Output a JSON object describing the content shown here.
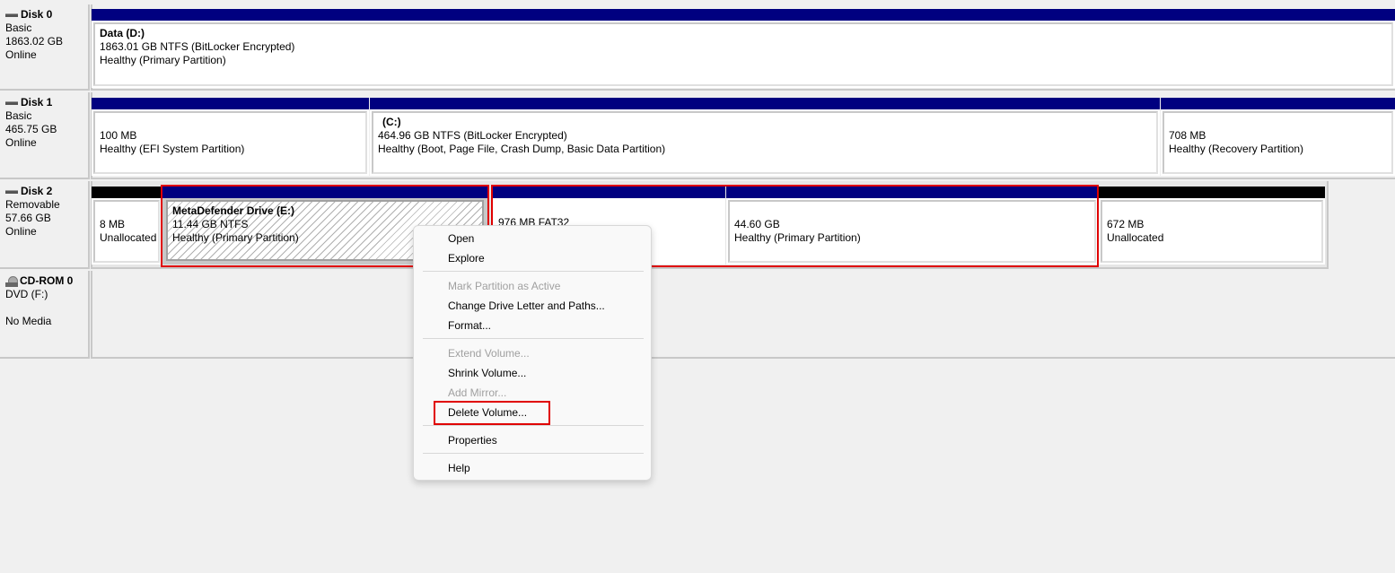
{
  "disks": [
    {
      "name": "Disk 0",
      "type": "Basic",
      "size": "1863.02 GB",
      "status": "Online",
      "partitions": [
        {
          "title": "Data  (D:)",
          "line1": "1863.01 GB NTFS (BitLocker Encrypted)",
          "line2": "Healthy (Primary Partition)"
        }
      ]
    },
    {
      "name": "Disk 1",
      "type": "Basic",
      "size": "465.75 GB",
      "status": "Online",
      "partitions": [
        {
          "line1": "100 MB",
          "line2": "Healthy (EFI System Partition)"
        },
        {
          "title": "(C:)",
          "line1": "464.96 GB NTFS (BitLocker Encrypted)",
          "line2": "Healthy (Boot, Page File, Crash Dump, Basic Data Partition)"
        },
        {
          "line1": "708 MB",
          "line2": "Healthy (Recovery Partition)"
        }
      ]
    },
    {
      "name": "Disk 2",
      "type": "Removable",
      "size": "57.66 GB",
      "status": "Online",
      "partitions": [
        {
          "line1": "8 MB",
          "line2": "Unallocated"
        },
        {
          "title": "MetaDefender Drive  (E:)",
          "line1": "11.44 GB NTFS",
          "line2": "Healthy (Primary Partition)"
        },
        {
          "line1": "976 MB FAT32"
        },
        {
          "line1": "44.60 GB",
          "line2": "Healthy (Primary Partition)"
        },
        {
          "line1": "672 MB",
          "line2": "Unallocated"
        }
      ]
    }
  ],
  "cdrom": {
    "name": "CD-ROM 0",
    "type": "DVD (F:)",
    "status": "No Media"
  },
  "context_menu": {
    "open": "Open",
    "explore": "Explore",
    "mark_active": "Mark Partition as Active",
    "change_letter": "Change Drive Letter and Paths...",
    "format": "Format...",
    "extend": "Extend Volume...",
    "shrink": "Shrink Volume...",
    "add_mirror": "Add Mirror...",
    "delete": "Delete Volume...",
    "properties": "Properties",
    "help": "Help"
  },
  "colors": {
    "primary_bar": "#000080",
    "unallocated_bar": "#000000",
    "highlight": "#e00000"
  }
}
